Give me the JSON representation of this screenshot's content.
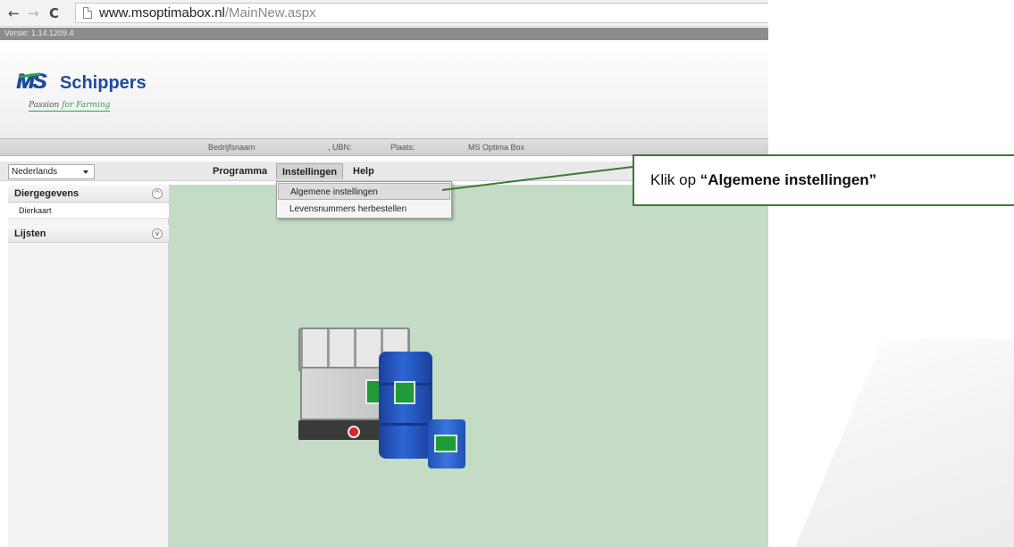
{
  "browser": {
    "back_icon": "←",
    "forward_icon": "→",
    "reload_icon": "C",
    "url_domain": "www.msoptimabox.nl",
    "url_path": "/MainNew.aspx"
  },
  "app": {
    "version": "Versie: 1.14.1209.4",
    "logo_ms": "MS",
    "logo_name": "Schippers",
    "logo_tagline_1": "Passion ",
    "logo_tagline_2": "for Farming"
  },
  "info_bar": {
    "bedrijfsnaam_label": "Bedrijfsnaam",
    "ubn_label": ", UBN:",
    "plaats_label": "Plaats:",
    "product_name": "MS Optima Box"
  },
  "menu": {
    "language": "Nederlands",
    "programma": "Programma",
    "instellingen": "Instellingen",
    "help": "Help",
    "dropdown": {
      "algemene": "Algemene instellingen",
      "levensnummers": "Levensnummers herbestellen"
    }
  },
  "sidebar": {
    "diergegevens": "Diergegevens",
    "dierkaart": "Dierkaart",
    "lijsten": "Lijsten",
    "collapse_icon": "^",
    "expand_icon": "v"
  },
  "callout": {
    "prefix": "Klik op ",
    "emphasis": "“Algemene instellingen”"
  },
  "colors": {
    "main_background": "#c4dcc5",
    "callout_border": "#3c7a33",
    "brand_blue": "#1e4b9a",
    "brand_green": "#2aa34a"
  }
}
